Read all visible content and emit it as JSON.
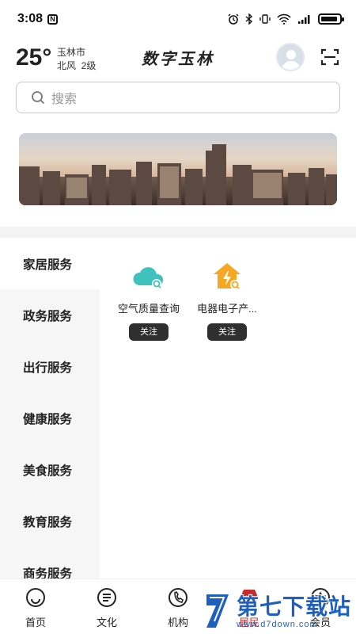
{
  "status_bar": {
    "time": "3:08",
    "nfc_label": "N",
    "battery_level": 0.9,
    "icons": [
      "nfc-icon",
      "alarm-icon",
      "bluetooth-icon",
      "vibrate-icon",
      "wifi-icon",
      "signal-icon",
      "battery-icon"
    ]
  },
  "header": {
    "temperature": "25°",
    "city": "玉林市",
    "wind": "北风  2级",
    "app_title": "数字玉林",
    "icons": [
      "avatar",
      "scan-icon"
    ]
  },
  "search": {
    "placeholder": "搜索",
    "icon": "search-icon"
  },
  "banner": {
    "icon": "city-skyline-image"
  },
  "side_nav": {
    "active_index": 0,
    "items": [
      {
        "label": "家居服务"
      },
      {
        "label": "政务服务"
      },
      {
        "label": "出行服务"
      },
      {
        "label": "健康服务"
      },
      {
        "label": "美食服务"
      },
      {
        "label": "教育服务"
      },
      {
        "label": "商务服务"
      }
    ]
  },
  "services": [
    {
      "label": "空气质量查询",
      "follow_label": "关注",
      "icon": "cloud-icon",
      "color": "#3fc1bd"
    },
    {
      "label": "电器电子产...",
      "follow_label": "关注",
      "icon": "house-bolt-icon",
      "color": "#f5a623"
    }
  ],
  "tabbar": {
    "active_index": 3,
    "active_color": "#c62a2a",
    "items": [
      {
        "label": "首页",
        "icon": "home-icon"
      },
      {
        "label": "文化",
        "icon": "culture-icon"
      },
      {
        "label": "机构",
        "icon": "phone-icon"
      },
      {
        "label": "居民",
        "icon": "shop-icon"
      },
      {
        "label": "会员",
        "icon": "member-icon"
      }
    ]
  },
  "watermark": {
    "title": "第七下载站",
    "url": "www.d7down.com"
  }
}
